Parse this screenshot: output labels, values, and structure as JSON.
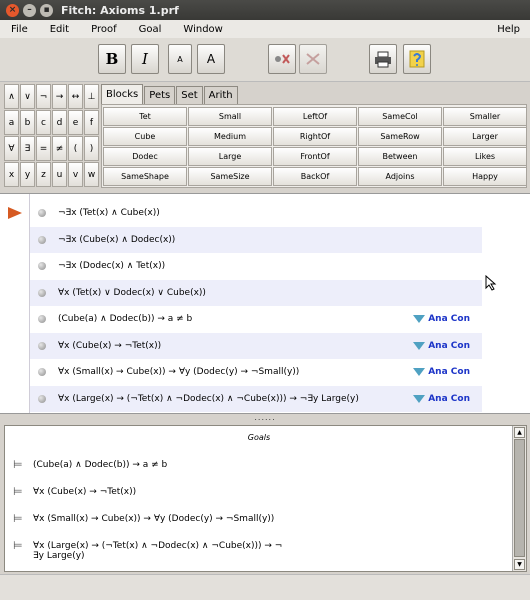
{
  "window": {
    "title": "Fitch: Axioms 1.prf"
  },
  "menu": {
    "items": [
      "File",
      "Edit",
      "Proof",
      "Goal",
      "Window"
    ],
    "help": "Help"
  },
  "toolbar": {
    "bold": "B",
    "italic": "I",
    "small_a": "A",
    "large_a": "A"
  },
  "symbols": [
    [
      "∧",
      "∨",
      "¬",
      "→",
      "↔",
      "⊥"
    ],
    [
      "a",
      "b",
      "c",
      "d",
      "e",
      "f"
    ],
    [
      "∀",
      "∃",
      "=",
      "≠",
      "(",
      ")"
    ],
    [
      "x",
      "y",
      "z",
      "u",
      "v",
      "w"
    ]
  ],
  "tabs": [
    "Blocks",
    "Pets",
    "Set",
    "Arith"
  ],
  "predicates": [
    "Tet",
    "Small",
    "LeftOf",
    "SameCol",
    "Smaller",
    "Cube",
    "Medium",
    "RightOf",
    "SameRow",
    "Larger",
    "Dodec",
    "Large",
    "FrontOf",
    "Between",
    "Likes",
    "SameShape",
    "SameSize",
    "BackOf",
    "Adjoins",
    "Happy"
  ],
  "proof": {
    "lines": [
      {
        "formula": "¬∃x (Tet(x) ∧ Cube(x))",
        "rule": ""
      },
      {
        "formula": "¬∃x (Cube(x) ∧ Dodec(x))",
        "rule": ""
      },
      {
        "formula": "¬∃x (Dodec(x) ∧ Tet(x))",
        "rule": ""
      },
      {
        "formula": "∀x (Tet(x) ∨ Dodec(x) ∨ Cube(x))",
        "rule": ""
      },
      {
        "formula": "(Cube(a) ∧ Dodec(b)) → a ≠ b",
        "rule": "Ana Con"
      },
      {
        "formula": "∀x (Cube(x) → ¬Tet(x))",
        "rule": "Ana Con"
      },
      {
        "formula": "∀x (Small(x) → Cube(x)) → ∀y (Dodec(y) → ¬Small(y))",
        "rule": "Ana Con"
      },
      {
        "formula": "∀x (Large(x) → (¬Tet(x) ∧ ¬Dodec(x) ∧ ¬Cube(x))) → ¬∃y Large(y)",
        "rule": "Ana Con"
      }
    ]
  },
  "divider": "......",
  "goals": {
    "title": "Goals",
    "items": [
      {
        "line1": "(Cube(a) ∧ Dodec(b)) → a ≠ b",
        "line2": ""
      },
      {
        "line1": "∀x (Cube(x) → ¬Tet(x))",
        "line2": ""
      },
      {
        "line1": "∀x (Small(x) → Cube(x)) → ∀y (Dodec(y) → ¬Small(y))",
        "line2": ""
      },
      {
        "line1": "∀x (Large(x) → (¬Tet(x) ∧ ¬Dodec(x) ∧ ¬Cube(x))) → ¬",
        "line2": "∃y Large(y)"
      }
    ]
  }
}
